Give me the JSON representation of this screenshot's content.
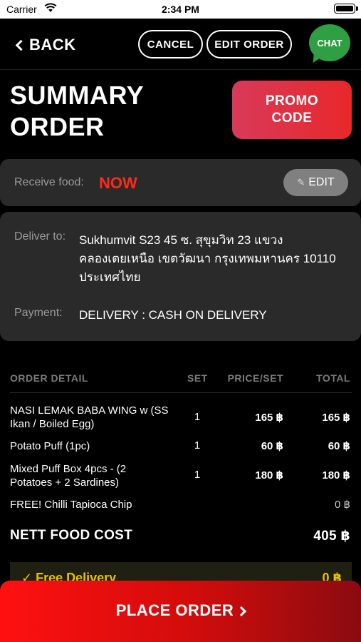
{
  "status_bar": {
    "carrier": "Carrier",
    "time": "2:34 PM"
  },
  "nav": {
    "back_label": "BACK",
    "cancel_label": "CANCEL",
    "edit_order_label": "EDIT ORDER",
    "chat_label": "CHAT"
  },
  "header": {
    "title_line1": "SUMMARY",
    "title_line2": "ORDER",
    "promo_line1": "PROMO",
    "promo_line2": "CODE"
  },
  "receive": {
    "label": "Receive food:",
    "value": "NOW",
    "edit_label": "EDIT"
  },
  "delivery": {
    "deliver_label": "Deliver to:",
    "address_line1": "Sukhumvit S23 45 ซ. สุขุมวิท 23 แขวง",
    "address_line2": "คลองเตยเหนือ เขตวัฒนา กรุงเทพมหานคร 10110",
    "address_line3": "ประเทศไทย",
    "payment_label": "Payment:",
    "payment_value": "DELIVERY : CASH ON DELIVERY"
  },
  "order": {
    "headers": {
      "detail": "ORDER DETAIL",
      "set": "SET",
      "price": "PRICE/SET",
      "total": "TOTAL"
    },
    "items": [
      {
        "name_line1": "NASI LEMAK BABA WING w (SS",
        "name_line2": "Ikan / Boiled Egg)",
        "set": "1",
        "price": "165 ฿",
        "total": "165 ฿"
      },
      {
        "name_line1": "Potato Puff (1pc)",
        "name_line2": "",
        "set": "1",
        "price": "60 ฿",
        "total": "60 ฿"
      },
      {
        "name_line1": "Mixed Puff Box 4pcs - (2",
        "name_line2": "Potatoes + 2 Sardines)",
        "set": "1",
        "price": "180 ฿",
        "total": "180 ฿"
      },
      {
        "name_line1": "FREE! Chilli Tapioca Chip",
        "name_line2": "",
        "set": "",
        "price": "",
        "total": "0 ฿"
      }
    ],
    "nett_label": "NETT FOOD COST",
    "nett_value": "405 ฿",
    "free_delivery_label": "✓ Free Delivery",
    "free_delivery_value": "0 ฿"
  },
  "place_order_label": "PLACE ORDER",
  "colors": {
    "accent_red": "#ff2a1a",
    "chat_green": "#2ea043",
    "card_bg": "#2a2a2a"
  }
}
